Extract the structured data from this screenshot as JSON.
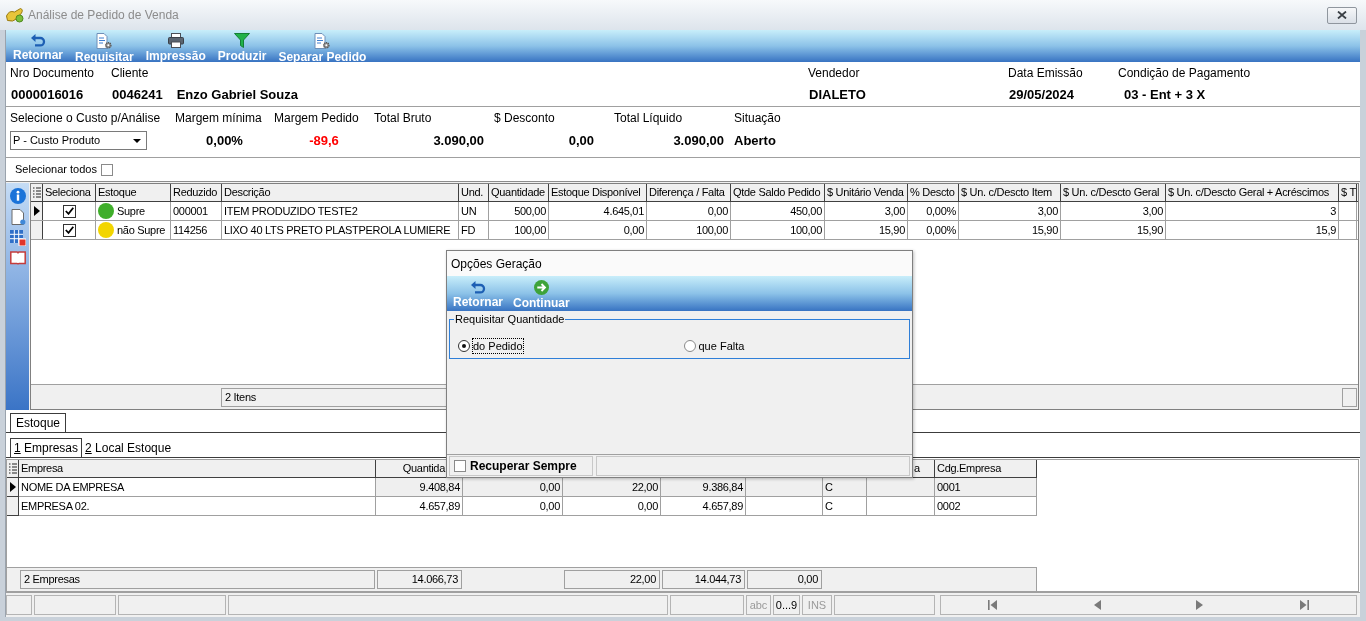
{
  "window": {
    "title": "Análise de Pedido de Venda"
  },
  "toolbar": [
    {
      "label": "Retornar"
    },
    {
      "label": "Requisitar"
    },
    {
      "label": "Impressão"
    },
    {
      "label": "Produzir"
    },
    {
      "label": "Separar Pedido"
    }
  ],
  "document": [
    {
      "label": "Nro Documento",
      "values": [
        "0000016016"
      ]
    },
    {
      "label": "Cliente",
      "values": [
        "0046241",
        "Enzo Gabriel Souza"
      ]
    },
    {
      "label": "Vendedor",
      "values": [
        "DIALETO"
      ]
    },
    {
      "label": "Data Emissão",
      "values": [
        "29/05/2024"
      ]
    },
    {
      "label": "Condição de Pagamento",
      "values": [
        "03 - Ent + 3 X"
      ]
    }
  ],
  "summary": {
    "cost_select": {
      "label": "Selecione o Custo p/Análise",
      "value": "P - Custo Produto"
    },
    "fields": [
      {
        "label": "Margem mínima",
        "value": "0,00%",
        "alert": false
      },
      {
        "label": "Margem Pedido",
        "value": "-89,6",
        "alert": true
      },
      {
        "label": "Total Bruto",
        "value": "3.090,00",
        "alert": false
      },
      {
        "label": "$ Desconto",
        "value": "0,00",
        "alert": false
      },
      {
        "label": "Total Líquido",
        "value": "3.090,00",
        "alert": false
      },
      {
        "label": "Situação",
        "value": "Aberto",
        "alert": false
      }
    ]
  },
  "select_all": {
    "label": "Selecionar todos",
    "checked": false
  },
  "items_grid": {
    "columns": [
      "Seleciona",
      "Estoque",
      "Reduzido",
      "Descrição",
      "Und.",
      "Quantidade",
      "Estoque Disponível",
      "Diferença / Falta",
      "Qtde Saldo Pedido",
      "$ Unitário Venda",
      "% Descto",
      "$ Un. c/Descto Item",
      "$ Un. c/Descto Geral",
      "$ Un. c/Descto Geral + Acréscimos",
      "$ T"
    ],
    "rows": [
      {
        "selected": true,
        "cells": [
          {
            "checked": true
          },
          {
            "label": "Supre",
            "color": "#3fae2a"
          },
          "000001",
          "ITEM PRODUZIDO TESTE2",
          "UN",
          "500,00",
          "4.645,01",
          "0,00",
          "450,00",
          "3,00",
          "0,00%",
          "3,00",
          "3,00",
          "3"
        ]
      },
      {
        "selected": false,
        "cells": [
          {
            "checked": true
          },
          {
            "label": "não Supre",
            "color": "#f2d500"
          },
          "114256",
          "LIXO 40 LTS PRETO PLASTPEROLA LUMIERE",
          "FD",
          "100,00",
          "0,00",
          "100,00",
          "100,00",
          "15,90",
          "0,00%",
          "15,90",
          "15,90",
          "15,9"
        ]
      }
    ],
    "footer": "2 Itens"
  },
  "stock_tabs": [
    {
      "label": "Estoque",
      "selected": true
    }
  ],
  "stock_subtabs": [
    {
      "label": "1 Empresas",
      "selected": true
    },
    {
      "label": "2 Local Estoque",
      "selected": false
    }
  ],
  "companies_grid": {
    "columns": [
      "Empresa",
      "Quantida",
      "",
      "",
      "",
      "",
      "",
      "a",
      "Cdg.Empresa"
    ],
    "rows": [
      {
        "selected": true,
        "cells": [
          "NOME DA EMPRESA",
          "9.408,84",
          "0,00",
          "22,00",
          "9.386,84",
          "",
          "C",
          "",
          "0001"
        ]
      },
      {
        "selected": false,
        "cells": [
          "EMPRESA 02.",
          "4.657,89",
          "0,00",
          "0,00",
          "4.657,89",
          "",
          "C",
          "",
          "0002"
        ]
      }
    ],
    "totals": {
      "column_1": "2 Empresas",
      "column_2": "14.066,73",
      "column_4": "22,00",
      "column_5": "14.044,73",
      "column_6": "0,00"
    }
  },
  "status_bar": {
    "indicators": [
      {
        "label": "abc",
        "disabled": true
      },
      {
        "label": "0...9",
        "disabled": false
      },
      {
        "label": "INS",
        "disabled": true
      }
    ]
  },
  "dialog": {
    "title": "Opções Geração",
    "toolbar": [
      {
        "label": "Retornar"
      },
      {
        "label": "Continuar"
      }
    ],
    "group": {
      "title": "Requisitar Quantidade",
      "options": [
        {
          "label": "do Pedido",
          "selected": true
        },
        {
          "label": "que Falta",
          "selected": false
        }
      ]
    },
    "remember": {
      "label": "Recuperar Sempre",
      "checked": false
    }
  }
}
